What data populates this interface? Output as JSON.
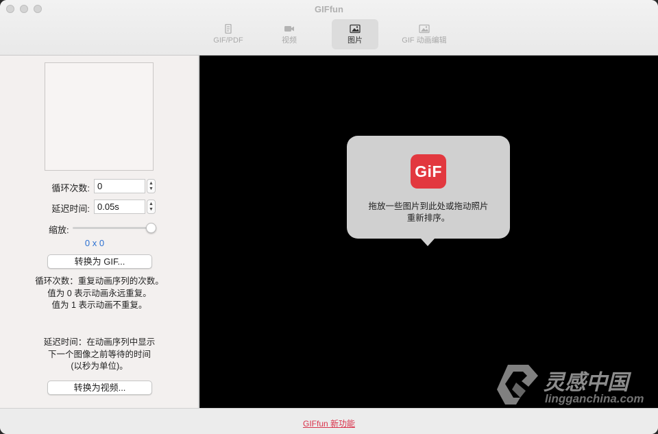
{
  "window": {
    "title": "GIFfun"
  },
  "tabs": [
    {
      "label": "GIF/PDF",
      "icon": "document-icon"
    },
    {
      "label": "视频",
      "icon": "video-camera-icon"
    },
    {
      "label": "图片",
      "icon": "image-icon"
    },
    {
      "label": "GIF 动画编辑",
      "icon": "image-edit-icon"
    }
  ],
  "active_tab": "图片",
  "sidebar": {
    "loop_label": "循环次数:",
    "loop_value": "0",
    "delay_label": "延迟时间:",
    "delay_value": "0.05s",
    "scale_label": "缩放:",
    "scale_level": 1.0,
    "dimensions": "0 x 0",
    "convert_gif_label": "转换为 GIF...",
    "help_loop": [
      "循环次数：重复动画序列的次数。",
      "值为 0 表示动画永远重复。",
      "值为 1 表示动画不重复。"
    ],
    "help_delay": [
      "延迟时间：在动画序列中显示",
      "下一个图像之前等待的时间",
      "(以秒为单位)。"
    ],
    "convert_video_label": "转换为视频..."
  },
  "drop_hint": {
    "logo_text": "GiF",
    "line1": "拖放一些图片到此处或拖动照片",
    "line2": "重新排序。"
  },
  "watermark": {
    "text": "灵感中国",
    "sub": "lingganchina.com"
  },
  "footer": {
    "link_label": "GIFfun 新功能"
  },
  "colors": {
    "accent_link": "#d9324b",
    "logo_red": "#e2383f",
    "dims_blue": "#2a6fd1"
  }
}
